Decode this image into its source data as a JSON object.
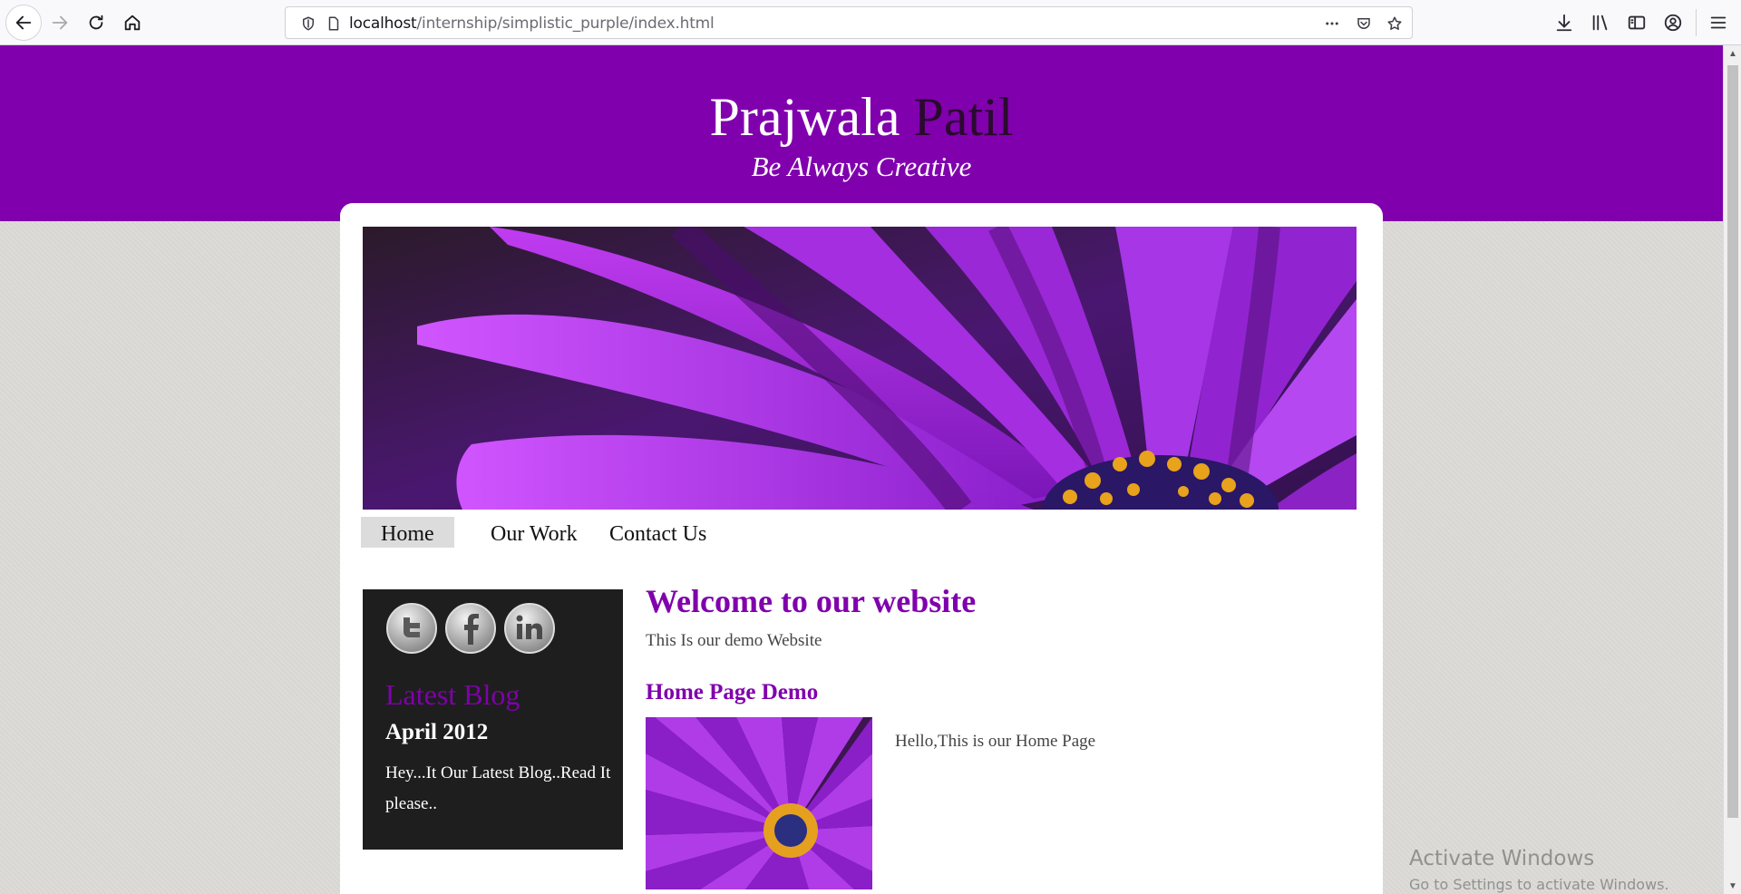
{
  "browser": {
    "url_host": "localhost",
    "url_path": "/internship/simplistic_purple/index.html"
  },
  "site": {
    "title_first": "Prajwala",
    "title_last": "Patil",
    "tagline": "Be Always Creative",
    "accent_color": "#8000ad"
  },
  "nav": {
    "items": [
      {
        "label": "Home",
        "active": true
      },
      {
        "label": "Our Work",
        "active": false
      },
      {
        "label": "Contact Us",
        "active": false
      }
    ]
  },
  "sidebar": {
    "social_icons": [
      "twitter-icon",
      "facebook-icon",
      "linkedin-icon"
    ],
    "heading": "Latest Blog",
    "date": "April 2012",
    "text": "Hey...It Our Latest Blog..Read It please.."
  },
  "main": {
    "heading": "Welcome to our website",
    "text": "This Is our demo Website",
    "subheading": "Home Page Demo",
    "image_text": "Hello,This is our Home Page"
  },
  "watermark": {
    "line1": "Activate Windows",
    "line2": "Go to Settings to activate Windows."
  }
}
